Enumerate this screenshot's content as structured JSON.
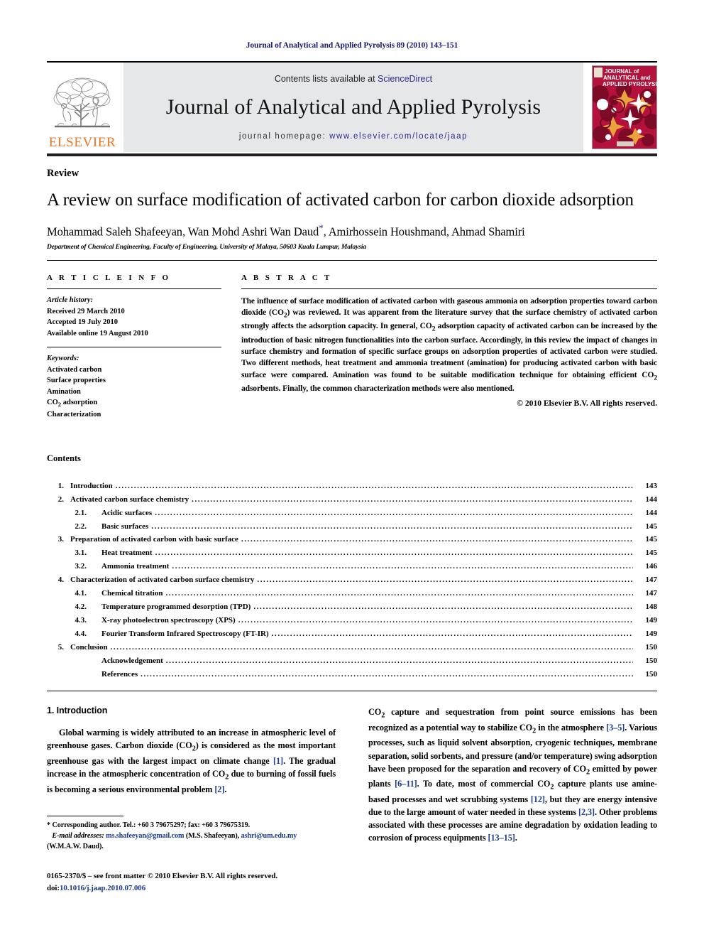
{
  "masthead": {
    "running_head": "Journal of Analytical and Applied Pyrolysis 89 (2010) 143–151",
    "contents_prefix": "Contents lists available at ",
    "sciencedirect": "ScienceDirect",
    "journal_title": "Journal of Analytical and Applied Pyrolysis",
    "homepage_prefix": "journal homepage: ",
    "homepage_url": "www.elsevier.com/locate/jaap",
    "publisher_wordmark": "ELSEVIER",
    "cover_line1": "JOURNAL of",
    "cover_line2": "ANALYTICAL and",
    "cover_line3": "APPLIED PYROLYSIS"
  },
  "colors": {
    "link_blue": "#2b2b8f",
    "ref_blue": "#1a3b8f",
    "elsevier_orange": "#E87722",
    "cover_red": "#b4123c",
    "band_gray": "#e6e7e8"
  },
  "article": {
    "doctype": "Review",
    "title": "A review on surface modification of activated carbon for carbon dioxide adsorption",
    "authors": "Mohammad Saleh Shafeeyan, Wan Mohd Ashri Wan Daud",
    "authors_tail": ", Amirhossein Houshmand, Ahmad Shamiri",
    "corresponding_marker": "*",
    "affiliation": "Department of Chemical Engineering, Faculty of Engineering, University of Malaya, 50603 Kuala Lumpur, Malaysia"
  },
  "article_info": {
    "heading": "A R T I C L E   I N F O",
    "history_label": "Article history:",
    "history": [
      "Received 29 March 2010",
      "Accepted 19 July 2010",
      "Available online 19 August 2010"
    ],
    "keywords_label": "Keywords:",
    "keywords": [
      "Activated carbon",
      "Surface properties",
      "Amination",
      "CO2 adsorption",
      "Characterization"
    ]
  },
  "abstract": {
    "heading": "A B S T R A C T",
    "text": "The influence of surface modification of activated carbon with gaseous ammonia on adsorption properties toward carbon dioxide (CO2) was reviewed. It was apparent from the literature survey that the surface chemistry of activated carbon strongly affects the adsorption capacity. In general, CO2 adsorption capacity of activated carbon can be increased by the introduction of basic nitrogen functionalities into the carbon surface. Accordingly, in this review the impact of changes in surface chemistry and formation of specific surface groups on adsorption properties of activated carbon were studied. Two different methods, heat treatment and ammonia treatment (amination) for producing activated carbon with basic surface were compared. Amination was found to be suitable modification technique for obtaining efficient CO2 adsorbents. Finally, the common characterization methods were also mentioned.",
    "copyright": "© 2010 Elsevier B.V. All rights reserved."
  },
  "contents": {
    "heading": "Contents",
    "entries": [
      {
        "level": 1,
        "num": "1.",
        "label": "Introduction",
        "page": "143"
      },
      {
        "level": 1,
        "num": "2.",
        "label": "Activated carbon surface chemistry",
        "page": "144"
      },
      {
        "level": 2,
        "num": "2.1.",
        "label": "Acidic surfaces",
        "page": "144"
      },
      {
        "level": 2,
        "num": "2.2.",
        "label": "Basic surfaces",
        "page": "145"
      },
      {
        "level": 1,
        "num": "3.",
        "label": "Preparation of activated carbon with basic surface",
        "page": "145"
      },
      {
        "level": 2,
        "num": "3.1.",
        "label": "Heat treatment",
        "page": "145"
      },
      {
        "level": 2,
        "num": "3.2.",
        "label": "Ammonia treatment",
        "page": "146"
      },
      {
        "level": 1,
        "num": "4.",
        "label": "Characterization of activated carbon surface chemistry",
        "page": "147"
      },
      {
        "level": 2,
        "num": "4.1.",
        "label": "Chemical titration",
        "page": "147"
      },
      {
        "level": 2,
        "num": "4.2.",
        "label": "Temperature programmed desorption (TPD)",
        "page": "148"
      },
      {
        "level": 2,
        "num": "4.3.",
        "label": "X-ray photoelectron spectroscopy (XPS)",
        "page": "149"
      },
      {
        "level": 2,
        "num": "4.4.",
        "label": "Fourier Transform Infrared Spectroscopy (FT-IR)",
        "page": "149"
      },
      {
        "level": 1,
        "num": "5.",
        "label": "Conclusion",
        "page": "150"
      },
      {
        "level": 3,
        "num": "",
        "label": "Acknowledgement",
        "page": "150"
      },
      {
        "level": 3,
        "num": "",
        "label": "References",
        "page": "150"
      }
    ]
  },
  "introduction": {
    "heading": "1.  Introduction",
    "left_para": "Global warming is widely attributed to an increase in atmospheric level of greenhouse gases. Carbon dioxide (CO2) is considered as the most important greenhouse gas with the largest impact on climate change [1]. The gradual increase in the atmospheric concentration of CO2 due to burning of fossil fuels is becoming a serious environmental problem [2].",
    "right_para": "CO2 capture and sequestration from point source emissions has been recognized as a potential way to stabilize CO2 in the atmosphere [3–5]. Various processes, such as liquid solvent absorption, cryogenic techniques, membrane separation, solid sorbents, and pressure (and/or temperature) swing adsorption have been proposed for the separation and recovery of CO2 emitted by power plants [6–11]. To date, most of commercial CO2 capture plants use amine-based processes and wet scrubbing systems [12], but they are energy intensive due to the large amount of water needed in these systems [2,3]. Other problems associated with these processes are amine degradation by oxidation leading to corrosion of process equipments [13–15]."
  },
  "footer": {
    "corresponding_star": "*",
    "corresponding_text": "Corresponding author. Tel.: +60 3 79675297; fax: +60 3 79675319.",
    "email_label": "E-mail addresses:",
    "email1": "ms.shafeeyan@gmail.com",
    "email1_owner": "(M.S. Shafeeyan),",
    "email2": "ashri@um.edu.my",
    "email2_owner": "(W.M.A.W. Daud).",
    "issn_line": "0165-2370/$ – see front matter © 2010 Elsevier B.V. All rights reserved.",
    "doi_label": "doi:",
    "doi_value": "10.1016/j.jaap.2010.07.006"
  }
}
